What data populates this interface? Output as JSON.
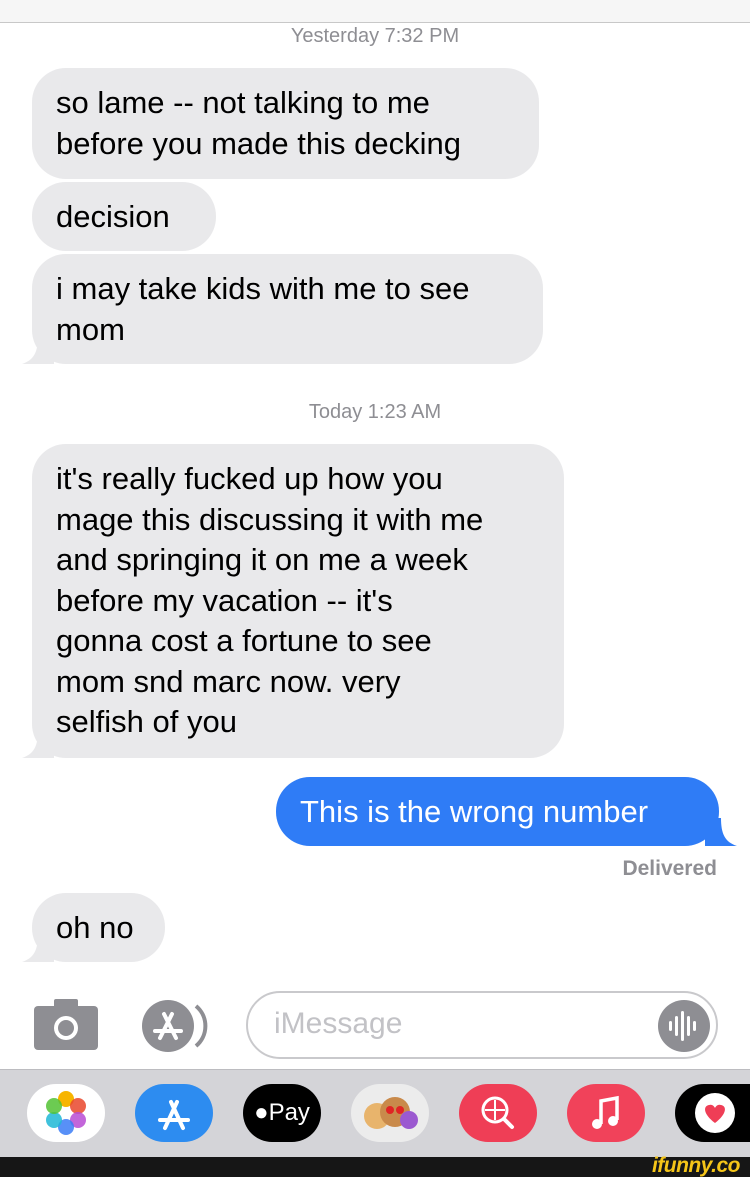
{
  "conversation": {
    "timestamp_1": "Yesterday 7:32 PM",
    "timestamp_2": "Today 1:23 AM",
    "messages": [
      {
        "lines": [
          "so lame -- not talking to me",
          "before you made this decking"
        ]
      },
      {
        "lines": [
          "decision"
        ]
      },
      {
        "lines": [
          "i may take kids with me to see",
          "mom"
        ]
      },
      {
        "lines": [
          "it's really fucked up how you",
          "mage this discussing it with me",
          "and springing it on me a week",
          "before my vacation -- it's",
          "gonna cost a fortune to see",
          "mom snd marc now. very",
          "selfish of you"
        ]
      },
      {
        "lines": [
          "This is the wrong number"
        ]
      },
      {
        "lines": [
          "oh no"
        ]
      }
    ],
    "delivered_label": "Delivered"
  },
  "composer": {
    "placeholder": "iMessage"
  },
  "app_tray": {
    "apple_pay_label": "Pay"
  },
  "watermark": "ifunny.co",
  "colors": {
    "incoming_bubble": "#e9e9eb",
    "outgoing_bubble": "#2f7cf6",
    "timestamp_text": "#8e8e93"
  }
}
